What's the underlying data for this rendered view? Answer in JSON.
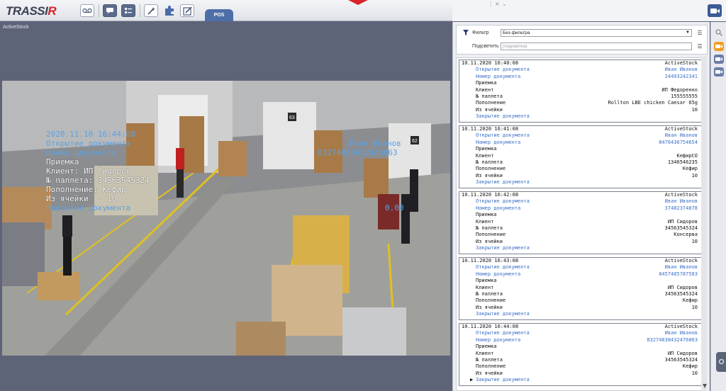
{
  "app": {
    "logo_main": "TRASSI",
    "logo_accent": "R",
    "active_tab": "POS"
  },
  "toolbar": {
    "buttons": [
      "voicemail-icon",
      "chat-icon",
      "list-icon",
      "magic-wand-icon",
      "puzzle-icon",
      "edit-box-icon"
    ]
  },
  "video": {
    "camera_label": "ActiveStock",
    "overlay_left": {
      "time": "2020.11.10 16:44:08",
      "open_doc": "Открытие документа",
      "doc_number": "Номер документа",
      "receive": "Приемка",
      "client": "Клиент: ИП Сидоров",
      "pallet": "№ паллета: 34563545324",
      "replenish": "Пополнение: Кефир",
      "from_cell": "Из ячейки  : 10",
      "close_doc": "Закрытие документа"
    },
    "overlay_right": {
      "name": "Иван Иванов",
      "number": "8327483843247686З",
      "value": "0.00"
    },
    "dock_labels": [
      "63",
      "62"
    ]
  },
  "filters": {
    "filter_label": "Фильтр",
    "filter_value": "Без фильтра",
    "highlight_label": "Подсветить",
    "highlight_placeholder": "(подсветка)"
  },
  "events": [
    {
      "time": "10.11.2020 16:40:08",
      "source": "ActiveStock",
      "open_doc": "Открытие документа",
      "user": "Иван Иванов",
      "doc_number_label": "Номер документа",
      "doc_number": "24493242341",
      "type": "Приемка",
      "client_label": "Клиент",
      "client": "ИП Федоренко",
      "pallet_label": "№ паллета",
      "pallet": "155555555",
      "replenish_label": "Пополнение",
      "replenish": "Rollton LBE chicken Caesar 65g",
      "cell_label": "Из ячейки",
      "cell": "10",
      "close_doc": "Закрытие документа"
    },
    {
      "time": "10.11.2020 16:41:08",
      "source": "ActiveStock",
      "open_doc": "Открытие документа",
      "user": "Иван Иванов",
      "doc_number_label": "Номер документа",
      "doc_number": "8476436754654",
      "type": "Приемка",
      "client_label": "Клиент",
      "client": "КефирСО",
      "pallet_label": "№ паллета",
      "pallet": "1346546235",
      "replenish_label": "Пополнение",
      "replenish": "Кефир",
      "cell_label": "Из ячейки",
      "cell": "10",
      "close_doc": "Закрытие документа"
    },
    {
      "time": "10.11.2020 16:42:08",
      "source": "ActiveStock",
      "open_doc": "Открытие документа",
      "user": "Иван Иванов",
      "doc_number_label": "Номер документа",
      "doc_number": "37482374878",
      "type": "Приемка",
      "client_label": "Клиент",
      "client": "ИП Сидоров",
      "pallet_label": "№ паллета",
      "pallet": "34563545324",
      "replenish_label": "Пополнение",
      "replenish": "Консерва",
      "cell_label": "Из ячейки",
      "cell": "10",
      "close_doc": "Закрытие документа"
    },
    {
      "time": "10.11.2020 16:43:08",
      "source": "ActiveStock",
      "open_doc": "Открытие документа",
      "user": "Иван Иванов",
      "doc_number_label": "Номер документа",
      "doc_number": "8457485787583",
      "type": "Приемка",
      "client_label": "Клиент",
      "client": "ИП Сидоров",
      "pallet_label": "№ паллета",
      "pallet": "34563545324",
      "replenish_label": "Пополнение",
      "replenish": "Кефир",
      "cell_label": "Из ячейки",
      "cell": "10",
      "close_doc": "Закрытие документа"
    },
    {
      "time": "10.11.2020 16:44:08",
      "source": "ActiveStock",
      "open_doc": "Открытие документа",
      "user": "Иван Иванов",
      "doc_number_label": "Номер документа",
      "doc_number": "83274838432476863",
      "type": "Приемка",
      "client_label": "Клиент",
      "client": "ИП Сидоров",
      "pallet_label": "№ паллета",
      "pallet": "34563545324",
      "replenish_label": "Пополнение",
      "replenish": "Кефир",
      "cell_label": "Из ячейки",
      "cell": "10",
      "close_doc": "Закрытие документа",
      "current": true
    }
  ],
  "sidebar": {
    "buttons": [
      "search-icon",
      "video-camera-icon",
      "video-camera-icon",
      "video-camera-icon"
    ]
  },
  "colors": {
    "accent": "#4d6fa8",
    "link": "#3b70c9",
    "overlay_blue": "#5aa2e6",
    "brand_red": "#d8232a"
  }
}
